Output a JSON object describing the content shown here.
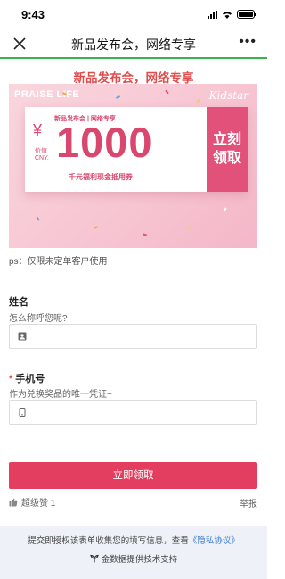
{
  "status_bar": {
    "time": "9:43"
  },
  "nav": {
    "title": "新品发布会，网络专享",
    "more": "•••"
  },
  "progress": {
    "fraction": 1.0,
    "color": "#3cb34a"
  },
  "heading": "新品发布会，网络专享",
  "banner": {
    "brand": "PRAISE LIFE",
    "logo": "Kidstar",
    "coupon": {
      "subtitle": "新品发布会 | 网络专享",
      "currency": "¥",
      "value_label": "价值CNY.",
      "amount": "1000",
      "caption": "千元福利现金抵用券",
      "claim_line1": "立刻",
      "claim_line2": "领取"
    }
  },
  "note": "ps：仅限未定单客户使用",
  "form": {
    "name": {
      "label": "姓名",
      "description": "怎么称呼您呢?",
      "value": "",
      "placeholder": ""
    },
    "phone": {
      "required_mark": "*",
      "label": "手机号",
      "description": "作为兑换奖品的唯一凭证~",
      "value": "",
      "placeholder": ""
    },
    "submit_label": "立即领取"
  },
  "social": {
    "like_label": "超级赞 1",
    "report_label": "举报"
  },
  "footer": {
    "consent_text": "提交即授权该表单收集您的填写信息，查看",
    "privacy_link": "《隐私协议》",
    "tech_support": "金数据提供技术支持"
  },
  "colors": {
    "accent": "#e33d5f",
    "heading": "#e24b4b",
    "link": "#3b7bd6"
  },
  "icons": [
    "close-icon",
    "more-icon",
    "person-icon",
    "phone-icon",
    "thumbs-up-icon",
    "jinshuju-logo-icon"
  ]
}
